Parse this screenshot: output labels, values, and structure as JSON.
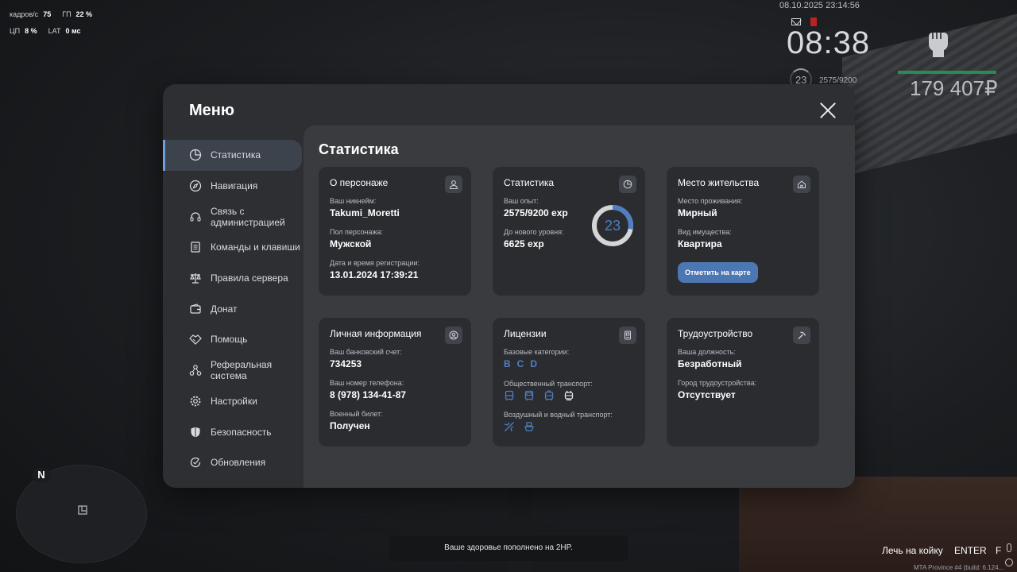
{
  "hud": {
    "fps_label": "кадров/с",
    "fps_value": "75",
    "gpu_label": "ГП",
    "gpu_value": "22 %",
    "cpu_label": "ЦП",
    "cpu_value": "8 %",
    "lat_label": "LAT",
    "lat_value": "0 мс",
    "datetime": "08.10.2025 23:14:56",
    "clock": "08:38",
    "level": "23",
    "exp": "2575/9200",
    "money": "179 407₽"
  },
  "menu": {
    "title": "Меню",
    "sidebar": [
      {
        "label": "Статистика",
        "icon": "pie-chart-icon",
        "active": true
      },
      {
        "label": "Навигация",
        "icon": "compass-icon"
      },
      {
        "label": "Связь с администрацией",
        "icon": "headset-icon"
      },
      {
        "label": "Команды и клавиши",
        "icon": "document-icon"
      },
      {
        "label": "Правила сервера",
        "icon": "scales-icon"
      },
      {
        "label": "Донат",
        "icon": "wallet-icon"
      },
      {
        "label": "Помощь",
        "icon": "handshake-icon"
      },
      {
        "label": "Реферальная система",
        "icon": "network-icon"
      },
      {
        "label": "Настройки",
        "icon": "gear-icon"
      },
      {
        "label": "Безопасность",
        "icon": "shield-icon"
      },
      {
        "label": "Обновления",
        "icon": "refresh-icon"
      }
    ]
  },
  "content": {
    "title": "Статистика",
    "character": {
      "title": "О персонаже",
      "nickname_label": "Ваш никнейм:",
      "nickname": "Takumi_Moretti",
      "gender_label": "Пол персонажа:",
      "gender": "Мужской",
      "reg_label": "Дата и время регистрации:",
      "reg": "13.01.2024 17:39:21"
    },
    "stats": {
      "title": "Статистика",
      "exp_label": "Ваш опыт:",
      "exp": "2575/9200 exp",
      "next_label": "До нового уровня:",
      "next": "6625 exp",
      "level": "23",
      "progress": 0.28
    },
    "residence": {
      "title": "Место жительства",
      "place_label": "Место проживания:",
      "place": "Мирный",
      "property_label": "Вид имущества:",
      "property": "Квартира",
      "map_button": "Отметить на карте"
    },
    "personal": {
      "title": "Личная информация",
      "bank_label": "Ваш банковский счет:",
      "bank": "734253",
      "phone_label": "Ваш номер телефона:",
      "phone": "8 (978) 134-41-87",
      "military_label": "Военный билет:",
      "military": "Получен"
    },
    "licenses": {
      "title": "Лицензии",
      "basic_label": "Базовые категории:",
      "categories": [
        "B",
        "C",
        "D"
      ],
      "public_label": "Общественный транспорт:",
      "public_icons": [
        "bus-icon",
        "bus-icon",
        "tram-icon",
        "trolley-icon"
      ],
      "airwater_label": "Воздушный и водный транспорт:",
      "airwater_icons": [
        "plane-icon",
        "boat-icon"
      ]
    },
    "employment": {
      "title": "Трудоустройство",
      "position_label": "Ваша должность:",
      "position": "Безработный",
      "city_label": "Город трудоустройства:",
      "city": "Отсутствует"
    }
  },
  "minimap": {
    "north": "N"
  },
  "notification": "Ваше здоровье пополнено на 2HP.",
  "hints": {
    "action": "Лечь на койку",
    "key": "ENTER",
    "key2": "F"
  },
  "build": "MTA Province #4 (build: 6.124..."
}
